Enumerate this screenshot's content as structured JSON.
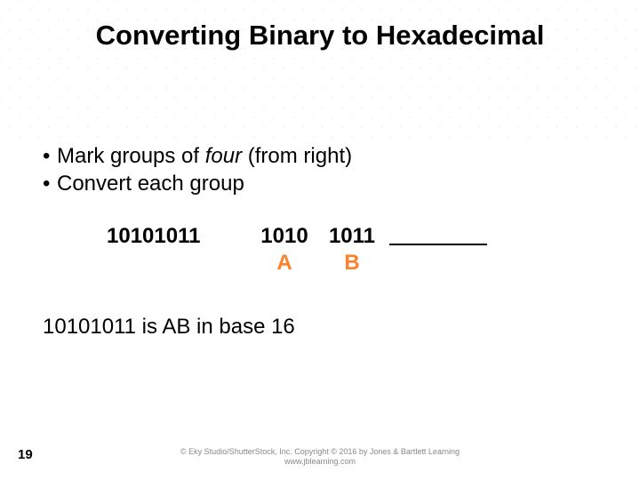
{
  "title": "Converting Binary to Hexadecimal",
  "bullets": {
    "b1_pre": "Mark groups of ",
    "b1_em": "four",
    "b1_post": " (from right)",
    "b2": "Convert each group"
  },
  "example": {
    "binary_full": "10101011",
    "group1": "1010",
    "group2": "1011",
    "hex1": "A",
    "hex2": "B"
  },
  "result_text": "10101011 is AB in base 16",
  "page_number": "19",
  "copyright": {
    "line1": "© Eky Studio/ShutterStock, Inc. Copyright © 2016 by Jones & Bartlett Learning",
    "line2": "www.jblearning.com"
  }
}
